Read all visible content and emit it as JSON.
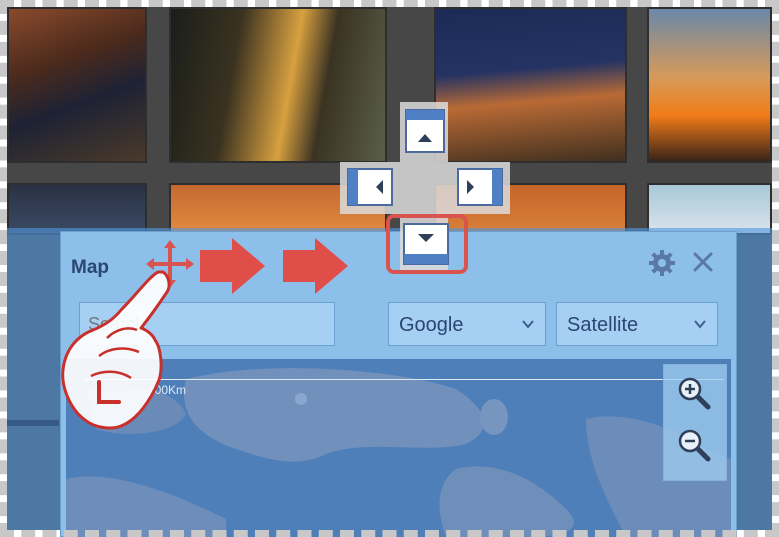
{
  "panel": {
    "title": "Map",
    "search_placeholder": "Search",
    "provider": {
      "selected": "Google"
    },
    "map_type": {
      "selected": "Satellite"
    },
    "scale_label": "100Km"
  },
  "icons": {
    "gear": "gear-icon",
    "close": "close-icon",
    "zoom_in": "zoom-in-icon",
    "zoom_out": "zoom-out-icon",
    "move": "move-cursor-icon",
    "hand": "pointing-hand-icon",
    "arrows": "right-arrow-icon"
  },
  "colors": {
    "accent_red": "#d9534f",
    "panel_bg": "#8cc0ea",
    "overlay_blue": "#5096dc",
    "title_text": "#2b4670"
  }
}
